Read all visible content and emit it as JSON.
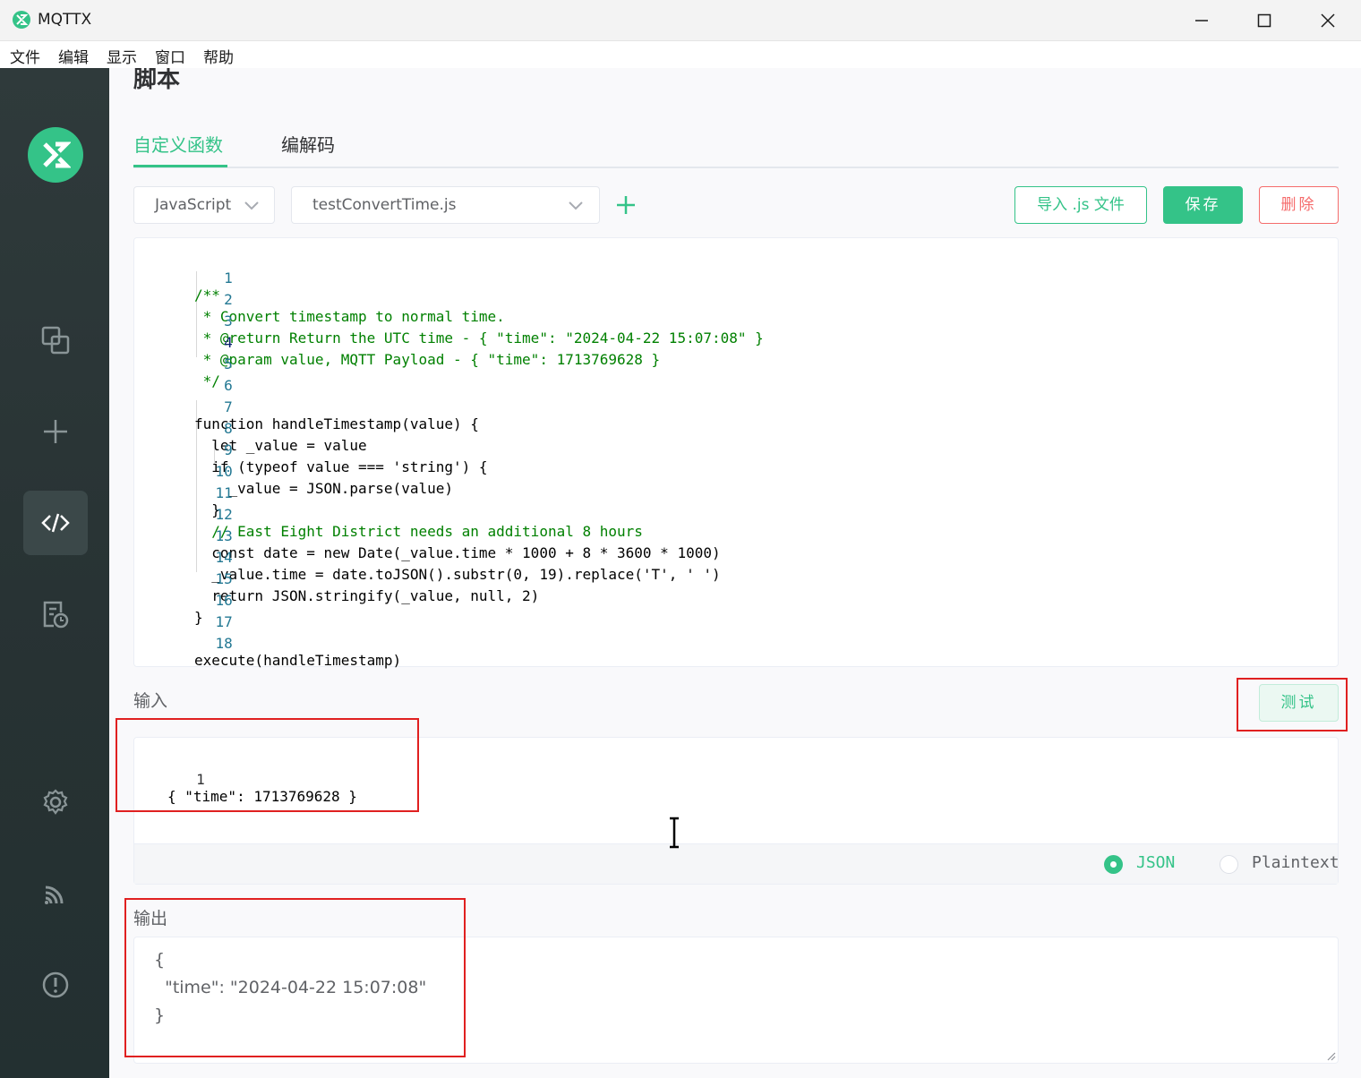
{
  "window": {
    "title": "MQTTX"
  },
  "menubar": {
    "items": [
      "文件",
      "编辑",
      "显示",
      "窗口",
      "帮助"
    ]
  },
  "sidebar": {
    "items": [
      {
        "name": "connections",
        "icon": "connections-icon"
      },
      {
        "name": "new-connection",
        "icon": "plus-icon"
      },
      {
        "name": "script",
        "icon": "code-icon",
        "active": true
      },
      {
        "name": "log",
        "icon": "log-icon"
      },
      {
        "name": "settings",
        "icon": "gear-icon"
      },
      {
        "name": "subscribe",
        "icon": "rss-icon"
      },
      {
        "name": "about",
        "icon": "info-icon"
      }
    ]
  },
  "page": {
    "title": "脚本",
    "tabs": [
      {
        "label": "自定义函数",
        "active": true
      },
      {
        "label": "编解码",
        "active": false
      }
    ]
  },
  "toolbar": {
    "language": "JavaScript",
    "file": "testConvertTime.js",
    "import_label": "导入 .js 文件",
    "save_label": "保存",
    "delete_label": "删除"
  },
  "editor": {
    "line_numbers": [
      "1",
      "2",
      "3",
      "4",
      "5",
      "6",
      "7",
      "8",
      "9",
      "10",
      "11",
      "12",
      "13",
      "14",
      "15",
      "16",
      "17",
      "18"
    ],
    "lines": [
      "/**",
      " * Convert timestamp to normal time.",
      " * @return Return the UTC time - { \"time\": \"2024-04-22 15:07:08\" }",
      " * @param value, MQTT Payload - { \"time\": 1713769628 }",
      " */",
      "",
      "function handleTimestamp(value) {",
      "  let _value = value",
      "  if (typeof value === 'string') {",
      "    _value = JSON.parse(value)",
      "  }",
      "  // East Eight District needs an additional 8 hours",
      "  const date = new Date(_value.time * 1000 + 8 * 3600 * 1000)",
      "  _value.time = date.toJSON().substr(0, 19).replace('T', ' ')",
      "  return JSON.stringify(_value, null, 2)",
      "}",
      "",
      "execute(handleTimestamp)"
    ]
  },
  "input": {
    "label": "输入",
    "test_label": "测试",
    "line_number": "1",
    "payload": "{ \"time\": 1713769628 }",
    "formats": [
      {
        "label": "JSON",
        "selected": true
      },
      {
        "label": "Plaintext",
        "selected": false
      }
    ]
  },
  "output": {
    "label": "输出",
    "lines": [
      "{",
      "  \"time\": \"2024-04-22 15:07:08\"",
      "}"
    ]
  },
  "colors": {
    "accent": "#34c388",
    "danger": "#f56c6c",
    "annotation": "#e02020",
    "sidebar_bg": "#2f3a3b"
  }
}
